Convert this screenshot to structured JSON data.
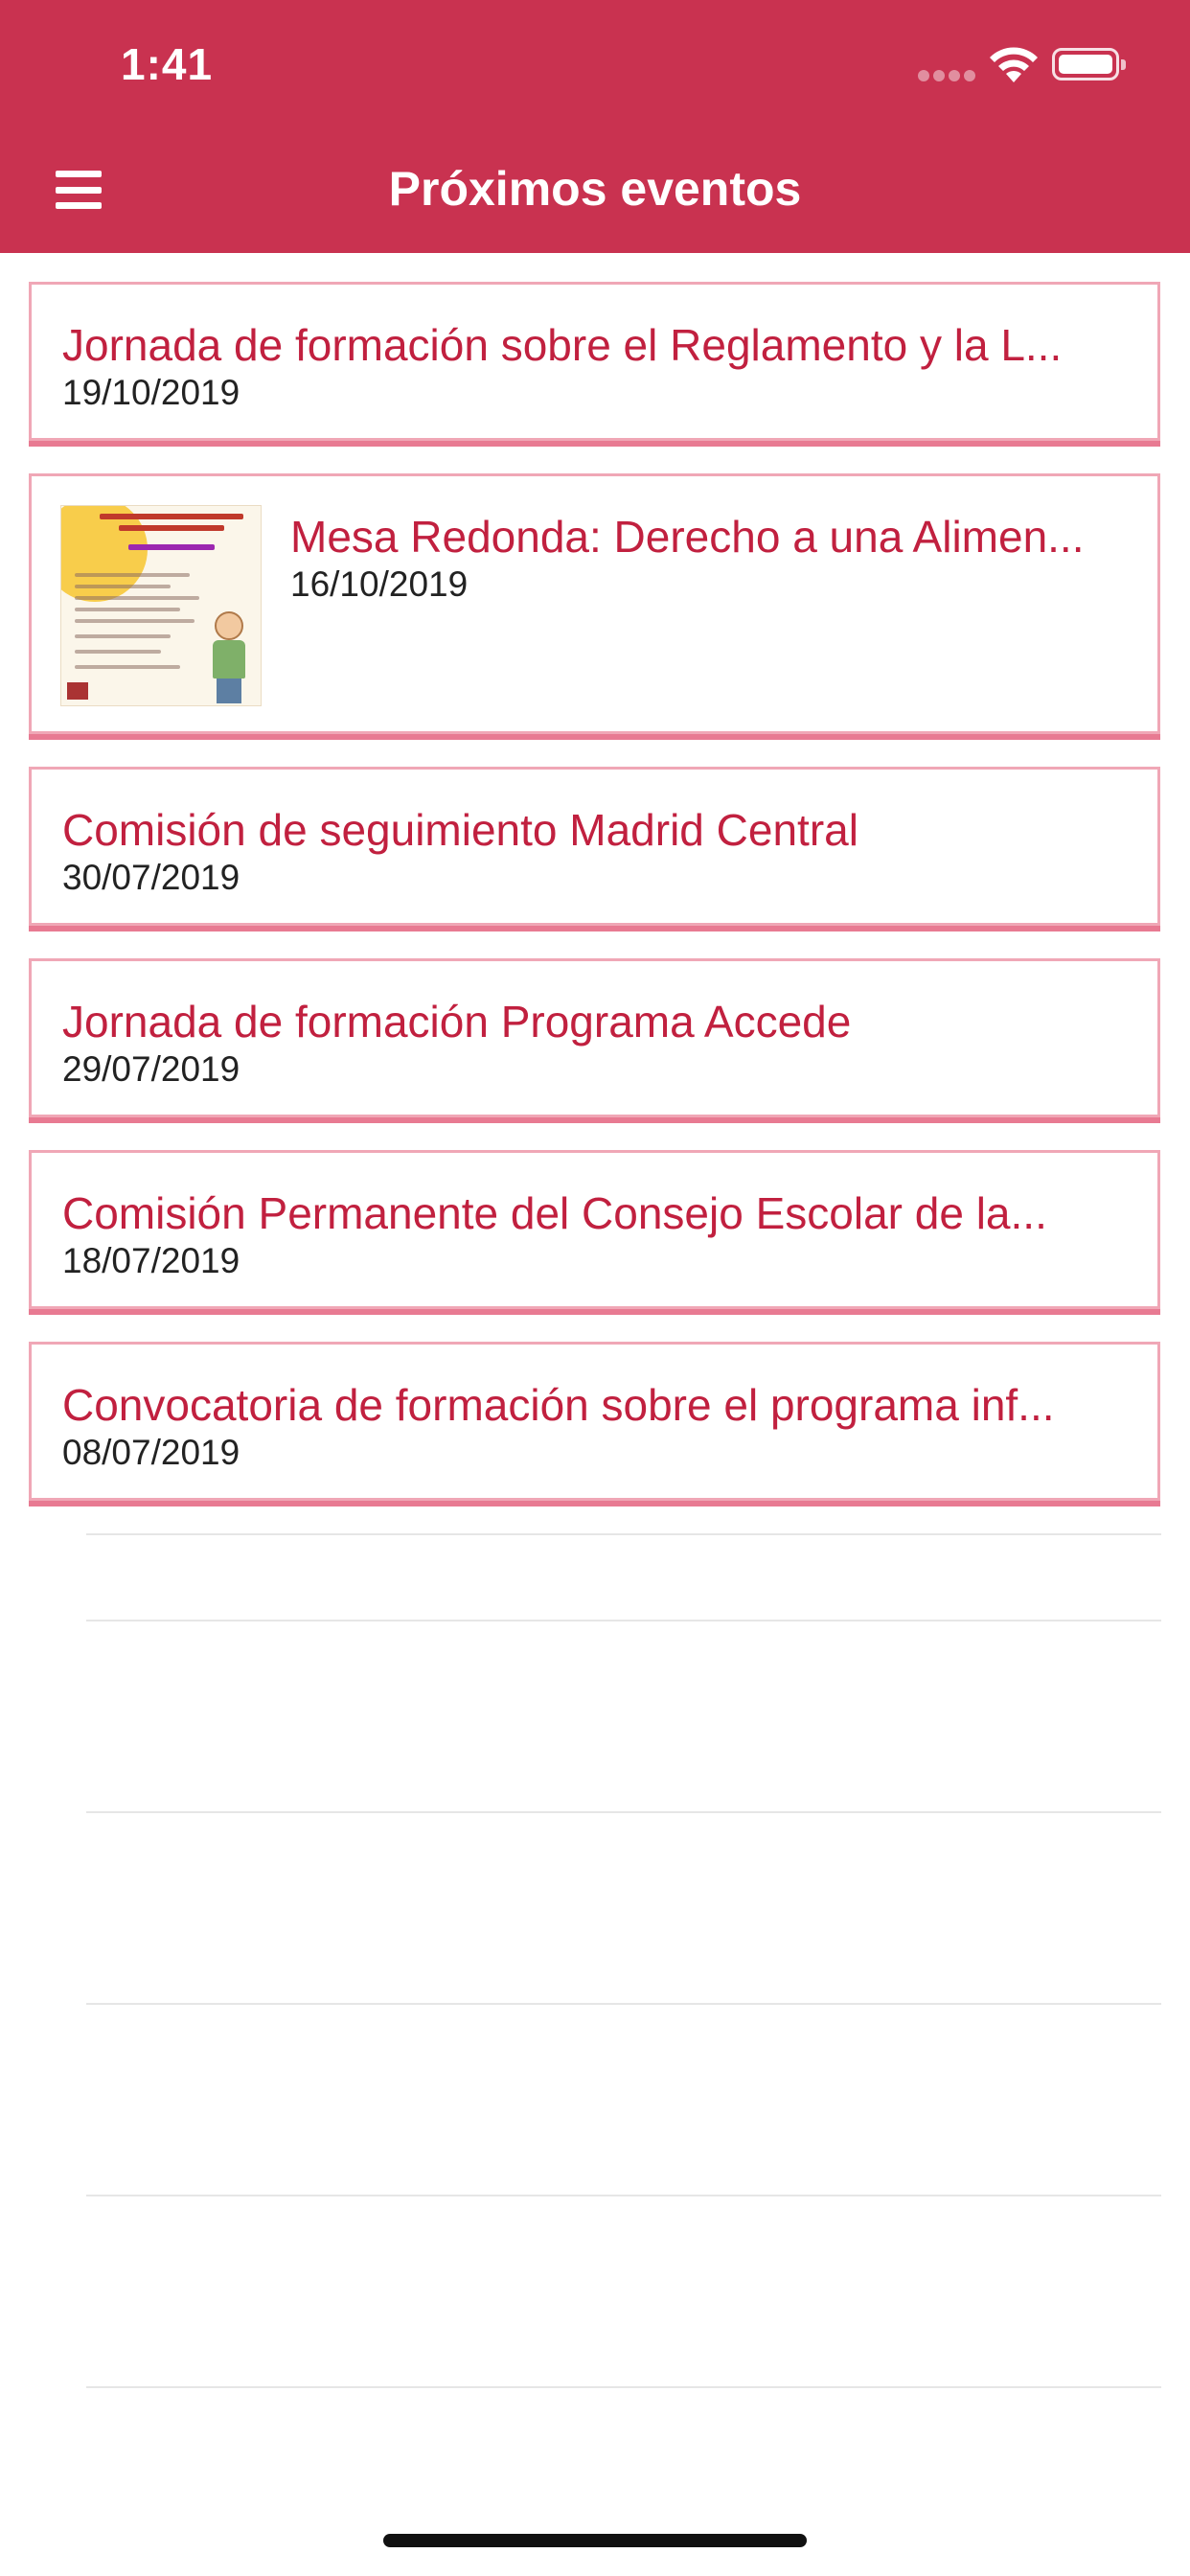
{
  "status_bar": {
    "time": "1:41"
  },
  "nav_bar": {
    "title": "Próximos eventos",
    "menu_icon": "hamburger-menu-icon"
  },
  "events": [
    {
      "title": "Jornada de formación sobre el Reglamento y la L...",
      "date": "19/10/2019",
      "has_image": false
    },
    {
      "title": "Mesa Redonda: Derecho a una Alimen...",
      "date": "16/10/2019",
      "has_image": true
    },
    {
      "title": "Comisión de seguimiento Madrid Central",
      "date": "30/07/2019",
      "has_image": false
    },
    {
      "title": "Jornada de formación Programa Accede",
      "date": "29/07/2019",
      "has_image": false
    },
    {
      "title": "Comisión Permanente del Consejo Escolar de la...",
      "date": "18/07/2019",
      "has_image": false
    },
    {
      "title": "Convocatoria de formación sobre el programa inf...",
      "date": "08/07/2019",
      "has_image": false
    }
  ],
  "colors": {
    "header": "#c93250",
    "title_text": "#c1203f",
    "card_border": "#f0a7b6"
  }
}
